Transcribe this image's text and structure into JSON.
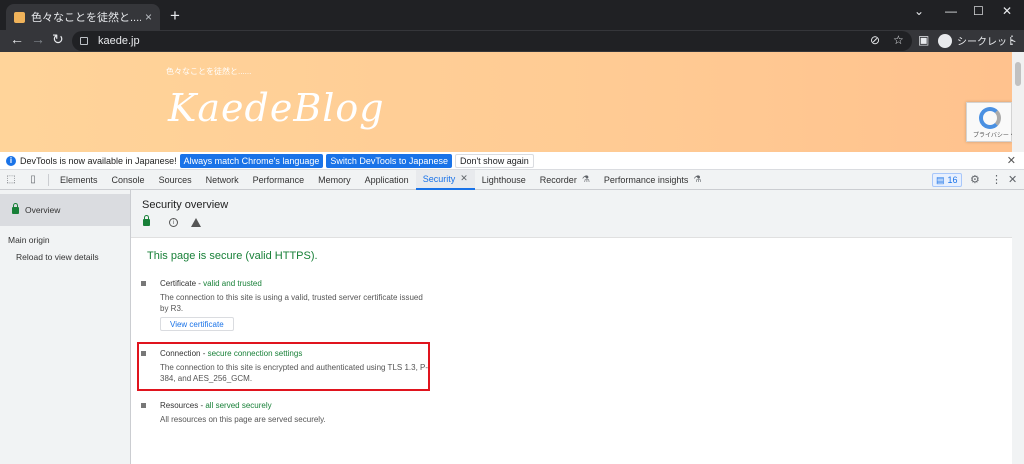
{
  "browser": {
    "tab_title": "色々なことを徒然と...... - かえでBlog",
    "new_tab": "+",
    "url": "kaede.jp",
    "incognito_label": "シークレット"
  },
  "site": {
    "tagline": "色々なことを徒然と......",
    "logo_text": "KaedeBlog",
    "recaptcha_text": "プライバシー・利用規約"
  },
  "infobar": {
    "message": "DevTools is now available in Japanese!",
    "btn_match": "Always match Chrome's language",
    "btn_switch": "Switch DevTools to Japanese",
    "btn_dismiss": "Don't show again"
  },
  "devtools": {
    "tabs": [
      {
        "label": "Elements"
      },
      {
        "label": "Console"
      },
      {
        "label": "Sources"
      },
      {
        "label": "Network"
      },
      {
        "label": "Performance"
      },
      {
        "label": "Memory"
      },
      {
        "label": "Application"
      },
      {
        "label": "Security"
      },
      {
        "label": "Lighthouse"
      },
      {
        "label": "Recorder"
      },
      {
        "label": "Performance insights"
      }
    ],
    "issues_count": "16"
  },
  "sidebar": {
    "overview": "Overview",
    "main_origin": "Main origin",
    "reload": "Reload to view details"
  },
  "security": {
    "title": "Security overview",
    "secure_message": "This page is secure (valid HTTPS).",
    "certificate": {
      "label": "Certificate - ",
      "status": "valid and trusted",
      "desc": "The connection to this site is using a valid, trusted server certificate issued by R3.",
      "button": "View certificate"
    },
    "connection": {
      "label": "Connection - ",
      "status": "secure connection settings",
      "desc": "The connection to this site is encrypted and authenticated using TLS 1.3, P-384, and AES_256_GCM."
    },
    "resources": {
      "label": "Resources - ",
      "status": "all served securely",
      "desc": "All resources on this page are served securely."
    }
  },
  "colors": {
    "secure_green": "#188038",
    "accent_blue": "#1a73e8",
    "highlight_red": "#e0141e",
    "banner_orange": "#ffcb94"
  }
}
